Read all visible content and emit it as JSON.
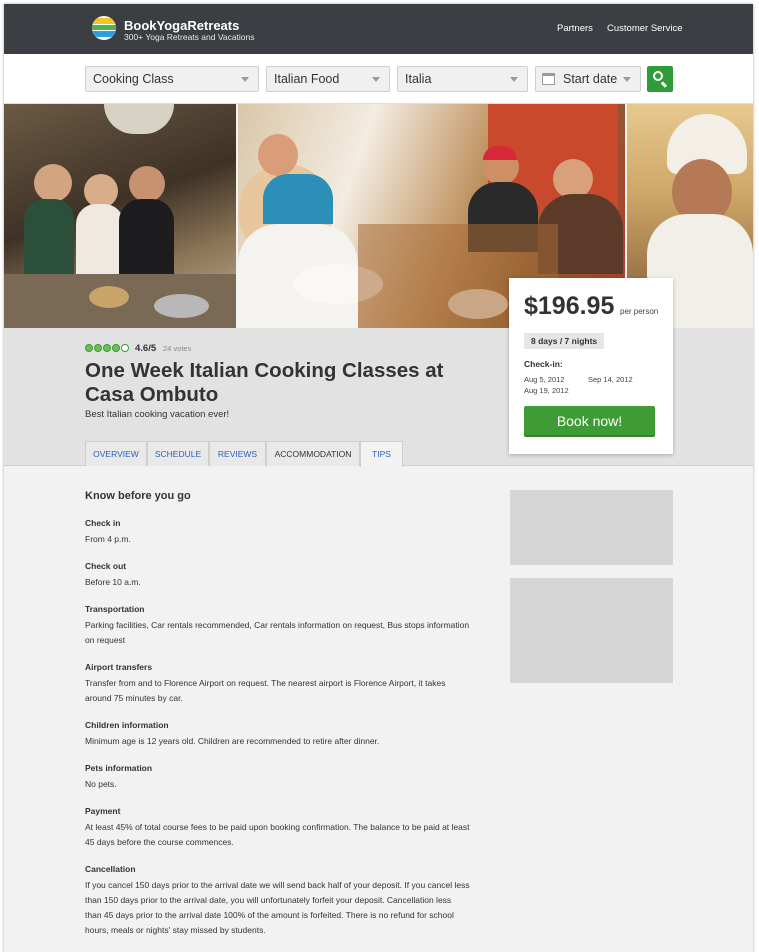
{
  "header": {
    "brand": "BookYogaRetreats",
    "tagline": "300+ Yoga Retreats and Vacations",
    "nav": [
      "Partners",
      "Customer Service"
    ]
  },
  "search": {
    "category": "Cooking Class",
    "style": "Italian Food",
    "location": "Italia",
    "date_placeholder": "Start date"
  },
  "listing": {
    "rating": "4.6/5",
    "rating_value": 4.6,
    "votes": "24 votes",
    "title": "One Week Italian Cooking Classes at Casa Ombuto",
    "subtitle": "Best Italian cooking vacation ever!",
    "tabs": [
      "OVERVIEW",
      "SCHEDULE",
      "REVIEWS",
      "ACCOMMODATION",
      "TIPS"
    ],
    "active_tab": "TIPS"
  },
  "booking": {
    "price": "$196.95",
    "per": "per person",
    "duration": "8 days / 7 nights",
    "checkin_label": "Check-in:",
    "dates": [
      "Aug 5, 2012",
      "Sep 14, 2012",
      "Aug 19, 2012"
    ],
    "book_label": "Book now!"
  },
  "tips": {
    "section_title": "Know before you go",
    "items": [
      {
        "heading": "Check in",
        "body": "From 4 p.m."
      },
      {
        "heading": "Check out",
        "body": "Before 10 a.m."
      },
      {
        "heading": "Transportation",
        "body": "Parking facilities, Car rentals recommended, Car rentals information on request, Bus stops information on request"
      },
      {
        "heading": "Airport transfers",
        "body": "Transfer from and to Florence Airport on request. The nearest airport is Florence Airport, it takes around 75 minutes by car."
      },
      {
        "heading": "Children information",
        "body": "Minimum age is 12 years old. Children are recommended to retire after dinner."
      },
      {
        "heading": "Pets information",
        "body": "No pets."
      },
      {
        "heading": "Payment",
        "body": "At least 45% of total course fees to be paid upon booking confirmation. The balance to be paid at least 45 days before the course commences."
      },
      {
        "heading": "Cancellation",
        "body": "If you cancel 150 days prior to the arrival date we will send back half of your deposit. If you cancel less than 150 days prior to the arrival date, you will unfortunately forfeit your deposit. Cancellation less than 45 days prior to the arrival date 100% of the amount is forfeited. There is no refund for school hours, meals or nights' stay missed by students."
      }
    ]
  },
  "colors": {
    "header_bg": "#3b3e43",
    "accent_green": "#3f9b35",
    "tab_link": "#2d5fb8"
  }
}
